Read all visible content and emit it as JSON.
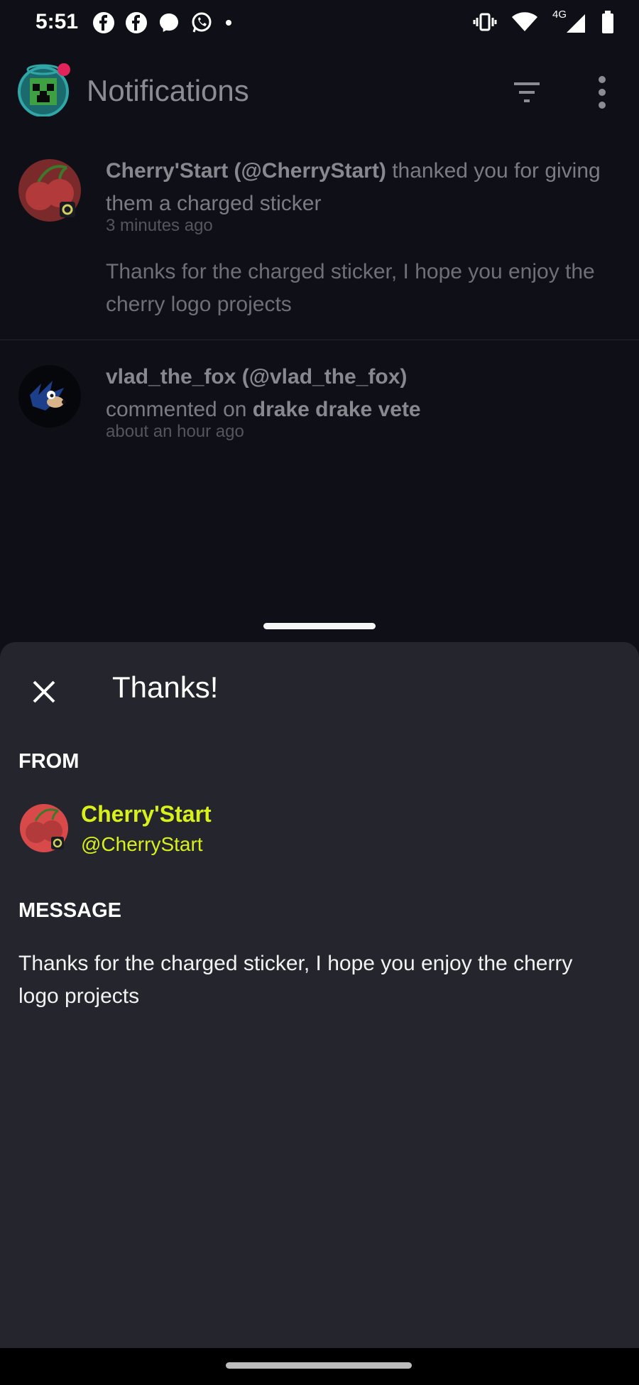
{
  "status": {
    "time": "5:51",
    "network": "4G"
  },
  "header": {
    "title": "Notifications"
  },
  "notifications": [
    {
      "name": "Cherry'Start",
      "handle": "(@CherryStart)",
      "action": "thanked you for giving them a charged sticker",
      "time": "3 minutes ago",
      "message": "Thanks for the charged sticker, I hope you enjoy the cherry logo projects"
    },
    {
      "name": "vlad_the_fox",
      "handle": "(@vlad_the_fox)",
      "action": "commented on",
      "target": "drake drake vete",
      "time": "about an hour ago"
    }
  ],
  "sheet": {
    "title": "Thanks!",
    "from_label": "FROM",
    "from_name": "Cherry'Start",
    "from_handle": "@CherryStart",
    "message_label": "MESSAGE",
    "message": "Thanks for the charged sticker, I hope you enjoy the cherry logo projects"
  },
  "colors": {
    "accent": "#d8f11a",
    "background": "#0f0f17",
    "sheet": "#25252d"
  }
}
